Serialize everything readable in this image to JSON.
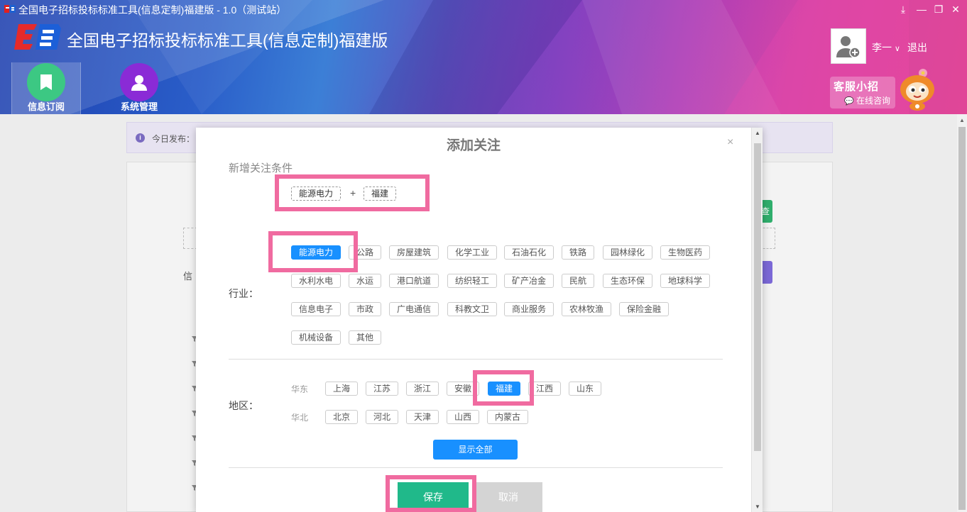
{
  "window": {
    "title": "全国电子招标投标标准工具(信息定制)福建版 - 1.0（测试站）",
    "controls": [
      "⤓",
      "—",
      "❐",
      "✕"
    ]
  },
  "app": {
    "title": "全国电子招标投标标准工具(信息定制)福建版"
  },
  "nav": {
    "items": [
      {
        "label": "信息订阅",
        "icon": "bookmark-icon",
        "color": "#3cc883",
        "active": true
      },
      {
        "label": "系统管理",
        "icon": "user-icon",
        "color": "#8a2bd6",
        "active": false
      }
    ]
  },
  "user": {
    "name": "李一",
    "logout": "退出"
  },
  "service": {
    "title": "客服小招",
    "subtitle": "在线咨询"
  },
  "background": {
    "info_label": "今日发布：",
    "side_label": "信",
    "green_button": "查"
  },
  "modal": {
    "title": "添加关注",
    "close": "×",
    "section_label": "新增关注条件",
    "conditions": [
      "能源电力",
      "福建"
    ],
    "plus": "+",
    "industry_label": "行业：",
    "industries": [
      [
        "能源电力",
        "公路",
        "房屋建筑",
        "化学工业",
        "石油石化",
        "铁路",
        "园林绿化",
        "生物医药"
      ],
      [
        "水利水电",
        "水运",
        "港口航道",
        "纺织轻工",
        "矿产冶金",
        "民航",
        "生态环保",
        "地球科学"
      ],
      [
        "信息电子",
        "市政",
        "广电通信",
        "科教文卫",
        "商业服务",
        "农林牧渔",
        "保险金融"
      ],
      [
        "机械设备",
        "其他"
      ]
    ],
    "selected_industry": "能源电力",
    "region_label": "地区：",
    "regions": [
      {
        "group": "华东",
        "items": [
          "上海",
          "江苏",
          "浙江",
          "安徽",
          "福建",
          "江西",
          "山东"
        ]
      },
      {
        "group": "华北",
        "items": [
          "北京",
          "河北",
          "天津",
          "山西",
          "内蒙古"
        ]
      }
    ],
    "selected_region": "福建",
    "show_all": "显示全部",
    "save": "保存",
    "cancel": "取消"
  },
  "colors": {
    "accent_blue": "#1890ff",
    "save_green": "#20b98a",
    "highlight_pink": "#f06ba0"
  }
}
